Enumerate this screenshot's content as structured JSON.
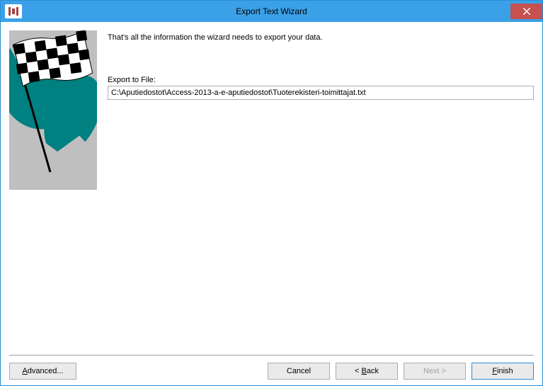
{
  "window": {
    "title": "Export Text Wizard"
  },
  "intro": "That's all the information the wizard needs to export your data.",
  "export": {
    "label": "Export to File:",
    "value": "C:\\Aputiedostot\\Access-2013-a-e-aputiedostot\\Tuoterekisteri-toimittajat.txt"
  },
  "buttons": {
    "advanced": "Advanced...",
    "cancel": "Cancel",
    "back": "< Back",
    "next": "Next >",
    "finish": "Finish"
  }
}
